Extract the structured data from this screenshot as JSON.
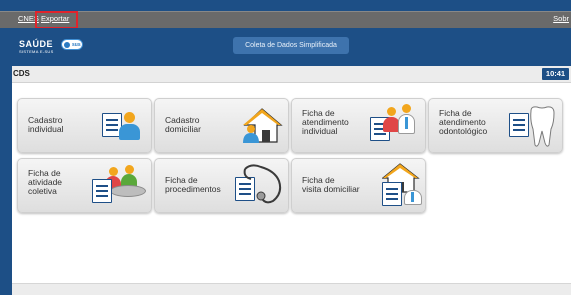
{
  "menu": {
    "cnes": "CNES",
    "exportar": "Exportar",
    "sobre": "Sobr"
  },
  "header": {
    "logo_text": "SAÚDE",
    "logo_sub": "SISTEMA E-SUS",
    "logo_badge": "sus",
    "app_title": "Coleta de Dados Simplificada"
  },
  "panel": {
    "title": "CDS",
    "clock": "10:41"
  },
  "tiles": [
    {
      "label": "Cadastro\nindividual",
      "icon": "person-form-icon"
    },
    {
      "label": "Cadastro\ndomiciliar",
      "icon": "house-person-icon"
    },
    {
      "label": "Ficha de\natendimento\nindividual",
      "icon": "professional-form-icon"
    },
    {
      "label": "Ficha de\natendimento\nodontológico",
      "icon": "tooth-form-icon"
    },
    {
      "label": "Ficha de\natividade\ncoletiva",
      "icon": "group-form-icon"
    },
    {
      "label": "Ficha de\nprocedimentos",
      "icon": "stethoscope-form-icon"
    },
    {
      "label": "Ficha de\nvisita domiciliar",
      "icon": "house-visit-form-icon"
    }
  ],
  "colors": {
    "brand_blue": "#1d4f86",
    "highlight_red": "#e0242c"
  }
}
